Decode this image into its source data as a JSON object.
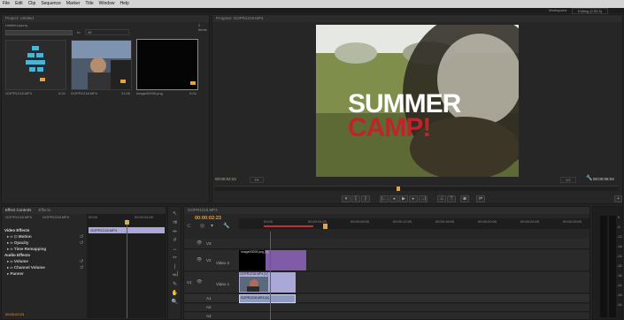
{
  "menu": [
    "File",
    "Edit",
    "Clip",
    "Sequence",
    "Marker",
    "Title",
    "Window",
    "Help"
  ],
  "workspace_label": "Workspace:",
  "workspace_value": "Editing (CS5.5)",
  "project": {
    "title": "Project: Untitled",
    "file": "Untitled.prproj",
    "item_count": "2 Items",
    "search_in": "In:",
    "search_value": "All",
    "items": [
      {
        "name": "GOPR1218.MP4",
        "duration": "0:04",
        "kind": "sequence"
      },
      {
        "name": "GOPR1218.MP4",
        "duration": "21:06",
        "kind": "video"
      },
      {
        "name": "image00005.png",
        "duration": "0:04",
        "kind": "image"
      }
    ]
  },
  "program": {
    "title": "Program: GOPR1218.MP4",
    "overlay_line1": "SUMMER",
    "overlay_line2": "CAMP!",
    "timecode": "00:00:02:23",
    "duration": "00:00:06:04",
    "fit": "Fit",
    "quality": "1/2"
  },
  "effect_controls": {
    "tabs": [
      "Effect Controls",
      "Effects"
    ],
    "source": "GOPR1218.MP4",
    "sequence": "GOPR1218.MP4",
    "ruler": [
      "00:00",
      "00:00:04:00"
    ],
    "clip_label": "GOPR1218.MP4",
    "sections": [
      {
        "label": "Video Effects",
        "header": true
      },
      {
        "label": "Motion",
        "fx": true
      },
      {
        "label": "Opacity",
        "fx": true
      },
      {
        "label": "Time Remapping",
        "fx": true
      },
      {
        "label": "Audio Effects",
        "header": true
      },
      {
        "label": "Volume",
        "fx": true
      },
      {
        "label": "Channel Volume",
        "fx": true
      },
      {
        "label": "Panner",
        "fx": false
      }
    ],
    "timecode": "00:00:02:23"
  },
  "timeline": {
    "tab": "GOPR1218.MP4",
    "timecode": "00:00:02:23",
    "ruler": [
      "00:00",
      "00:00:04:00",
      "00:00:08:00",
      "00:00:12:00",
      "00:00:16:00",
      "00:00:20:00",
      "00:00:24:00",
      "00:00:28:00"
    ],
    "tracks": [
      {
        "id": "V3",
        "name": ""
      },
      {
        "id": "V2",
        "name": "Video 2"
      },
      {
        "id": "V1",
        "name": "Video 1"
      },
      {
        "id": "A1",
        "name": ""
      },
      {
        "id": "A2",
        "name": ""
      },
      {
        "id": "A3",
        "name": ""
      }
    ],
    "clips": {
      "image": "image00005.png [V]",
      "video": "GOPR1218.MP4 [V]",
      "audio": "GOPR1218.MP4 [A]"
    },
    "meter_labels": [
      "0",
      "-6",
      "-12",
      "-18",
      "-24",
      "-30",
      "-36",
      "-42",
      "-48",
      "-54"
    ]
  },
  "colors": {
    "accent": "#e8a33c",
    "clip_purple": "#7f5ba8",
    "clip_video": "#a9a8d6",
    "playhead": "#d03030"
  }
}
